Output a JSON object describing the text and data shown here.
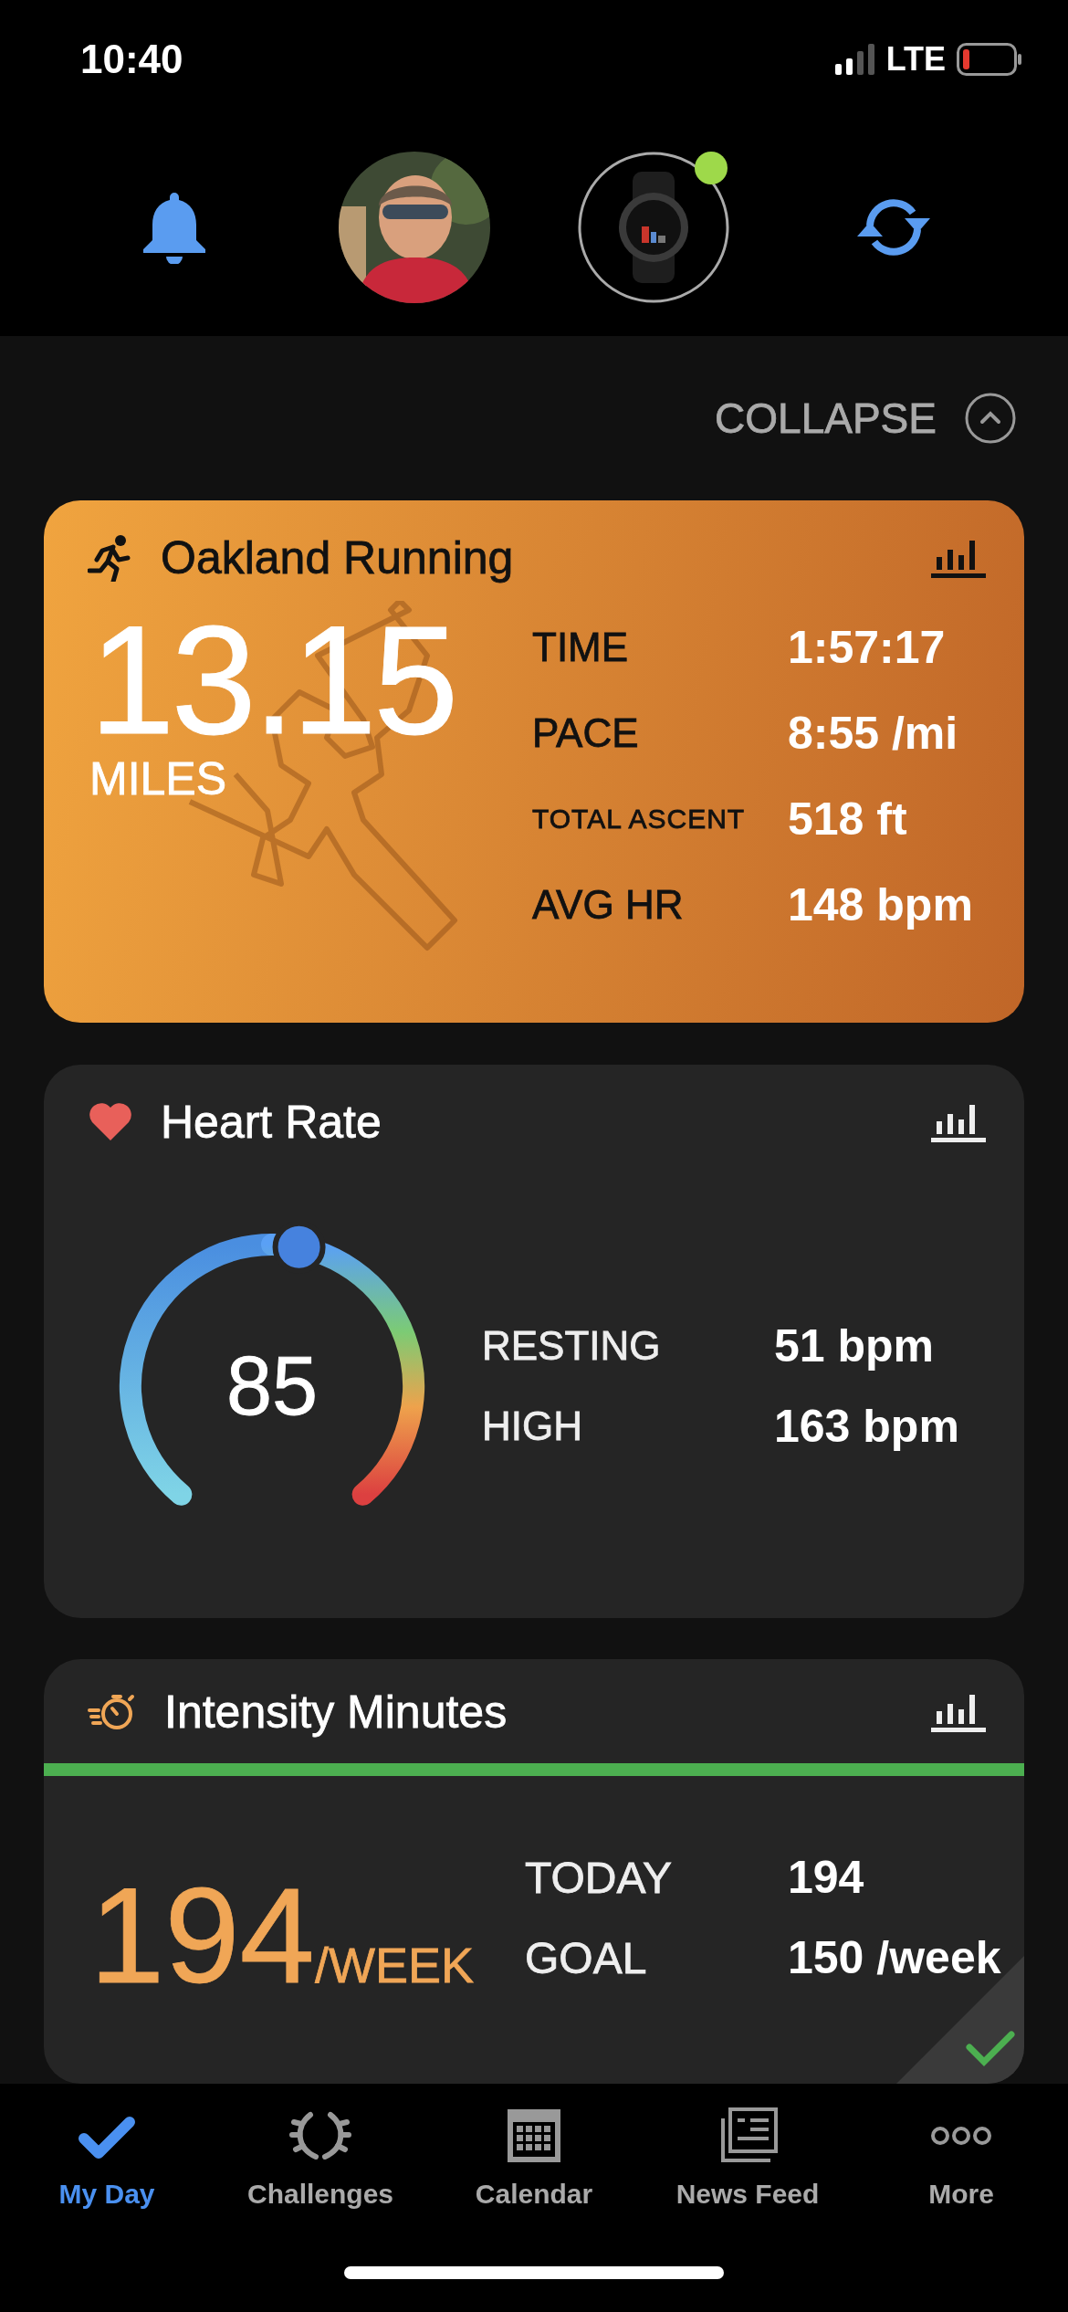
{
  "status_bar": {
    "time": "10:40",
    "network": "LTE",
    "battery_low": true
  },
  "header": {
    "device_connected": true
  },
  "collapse": {
    "label": "COLLAPSE"
  },
  "activity": {
    "title": "Oakland Running",
    "distance": "13.15",
    "unit": "MILES",
    "stats": [
      {
        "label": "TIME",
        "value": "1:57:17",
        "kind": "normal"
      },
      {
        "label": "PACE",
        "value": "8:55 /mi",
        "kind": "normal"
      },
      {
        "label": "TOTAL ASCENT",
        "value": "518 ft",
        "kind": "small"
      },
      {
        "label": "AVG HR",
        "value": "148 bpm",
        "kind": "normal"
      }
    ]
  },
  "heart_rate": {
    "title": "Heart Rate",
    "current": "85",
    "stats": [
      {
        "label": "RESTING",
        "value": "51 bpm"
      },
      {
        "label": "HIGH",
        "value": "163 bpm"
      }
    ]
  },
  "intensity": {
    "title": "Intensity Minutes",
    "level": 1,
    "total": "194",
    "unit": "/WEEK",
    "goal_met": true,
    "stats": [
      {
        "label": "TODAY",
        "value": "194"
      },
      {
        "label": "GOAL",
        "value": "150 /week"
      }
    ]
  },
  "tabs": [
    {
      "label": "My Day",
      "kind": "check",
      "selected": true
    },
    {
      "label": "Challenges",
      "kind": "laurel",
      "selected": false
    },
    {
      "label": "Calendar",
      "kind": "calendar",
      "selected": false
    },
    {
      "label": "News Feed",
      "kind": "news",
      "selected": false
    },
    {
      "label": "More",
      "kind": "more",
      "selected": false
    }
  ]
}
